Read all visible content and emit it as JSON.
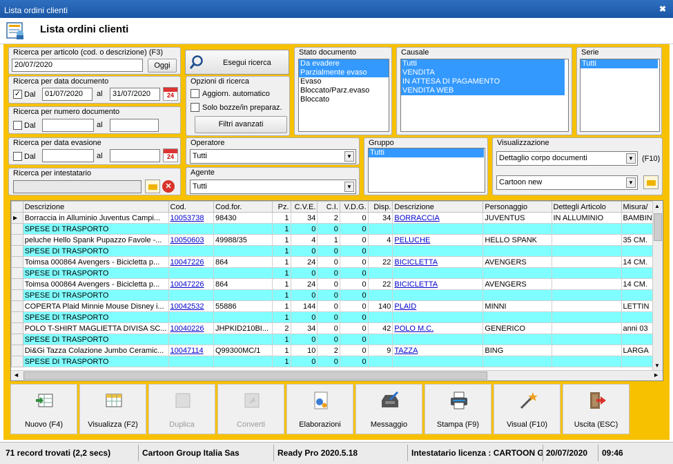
{
  "window": {
    "title": "Lista ordini clienti",
    "header_title": "Lista ordini clienti"
  },
  "search": {
    "article": {
      "legend": "Ricerca per articolo (cod. o descrizione) (F3)",
      "value": "20/07/2020",
      "today_btn": "Oggi"
    },
    "doc_date": {
      "legend": "Ricerca per data documento",
      "chk_label": "Dal",
      "checked": true,
      "from": "01/07/2020",
      "to_label": "al",
      "to": "31/07/2020"
    },
    "doc_num": {
      "legend": "Ricerca per numero documento",
      "chk_label": "Dal",
      "from": "",
      "to_label": "al",
      "to": ""
    },
    "evasion_date": {
      "legend": "Ricerca per data evasione",
      "chk_label": "Dal",
      "from": "",
      "to_label": "al",
      "to": ""
    },
    "holder": {
      "legend": "Ricerca per intestatario",
      "value": ""
    },
    "run_btn": "Esegui ricerca",
    "options": {
      "legend": "Opzioni di ricerca",
      "auto": "Aggiorn. automatico",
      "drafts": "Solo bozze/in preparaz.",
      "adv": "Filtri avanzati"
    },
    "operator": {
      "legend": "Operatore",
      "value": "Tutti"
    },
    "agent": {
      "legend": "Agente",
      "value": "Tutti"
    },
    "state": {
      "legend": "Stato documento",
      "items": [
        "Da evadere",
        "Parzialmente evaso",
        "Evaso",
        "Bloccato/Parz.evaso",
        "Bloccato"
      ],
      "selected": [
        true,
        true,
        false,
        false,
        false
      ]
    },
    "causale": {
      "legend": "Causale",
      "items": [
        "Tutti",
        "VENDITA",
        "IN ATTESA DI PAGAMENTO",
        "VENDITA WEB"
      ],
      "selected": [
        true,
        true,
        true,
        true
      ]
    },
    "serie": {
      "legend": "Serie",
      "items": [
        "Tutti"
      ]
    },
    "gruppo": {
      "legend": "Gruppo",
      "items": [
        "Tutti"
      ]
    },
    "view": {
      "legend": "Visualizzazione",
      "mode": "Dettaglio corpo documenti",
      "key": "(F10)",
      "layout": "Cartoon new"
    }
  },
  "grid": {
    "columns": [
      "Descrizione",
      "Cod.",
      "Cod.for.",
      "Pz.",
      "C.V.E.",
      "C.I.",
      "V.D.G.",
      "Disp.",
      "Descrizione",
      "Personaggio",
      "Dettegli Articolo",
      "Misura/"
    ],
    "rows": [
      {
        "c": [
          "Borraccia in Alluminio Juventus Campi...",
          "10053738",
          "98430",
          "1",
          "34",
          "2",
          "0",
          "34",
          "BORRACCIA",
          "JUVENTUS",
          "IN ALLUMINIO",
          "BAMBIN"
        ],
        "cyan": false,
        "cur": true
      },
      {
        "c": [
          "SPESE DI TRASPORTO",
          "",
          "",
          "1",
          "0",
          "0",
          "0",
          "",
          "",
          "",
          "",
          ""
        ],
        "cyan": true
      },
      {
        "c": [
          "peluche Hello Spank Pupazzo Favole -...",
          "10050603",
          "49988/35",
          "1",
          "4",
          "1",
          "0",
          "4",
          "PELUCHE",
          "HELLO SPANK",
          "",
          "35 CM."
        ],
        "cyan": false
      },
      {
        "c": [
          "SPESE DI TRASPORTO",
          "",
          "",
          "1",
          "0",
          "0",
          "0",
          "",
          "",
          "",
          "",
          ""
        ],
        "cyan": true
      },
      {
        "c": [
          "Toimsa 000864 Avengers - Bicicletta p...",
          "10047226",
          "864",
          "1",
          "24",
          "0",
          "0",
          "22",
          "BICICLETTA",
          "AVENGERS",
          "",
          "14 CM."
        ],
        "cyan": false
      },
      {
        "c": [
          "SPESE DI TRASPORTO",
          "",
          "",
          "1",
          "0",
          "0",
          "0",
          "",
          "",
          "",
          "",
          ""
        ],
        "cyan": true
      },
      {
        "c": [
          "Toimsa 000864 Avengers - Bicicletta p...",
          "10047226",
          "864",
          "1",
          "24",
          "0",
          "0",
          "22",
          "BICICLETTA",
          "AVENGERS",
          "",
          "14 CM."
        ],
        "cyan": false
      },
      {
        "c": [
          "SPESE DI TRASPORTO",
          "",
          "",
          "1",
          "0",
          "0",
          "0",
          "",
          "",
          "",
          "",
          ""
        ],
        "cyan": true
      },
      {
        "c": [
          "COPERTA Plaid Minnie Mouse Disney i...",
          "10042532",
          "55886",
          "1",
          "144",
          "0",
          "0",
          "140",
          "PLAID",
          "MINNI",
          "",
          "LETTIN"
        ],
        "cyan": false
      },
      {
        "c": [
          "SPESE DI TRASPORTO",
          "",
          "",
          "1",
          "0",
          "0",
          "0",
          "",
          "",
          "",
          "",
          ""
        ],
        "cyan": true
      },
      {
        "c": [
          "POLO T-SHIRT MAGLIETTA DIVISA SC...",
          "10040226",
          "JHPKID210BI...",
          "2",
          "34",
          "0",
          "0",
          "42",
          "POLO M.C.",
          "GENERICO",
          "",
          "anni 03"
        ],
        "cyan": false
      },
      {
        "c": [
          "SPESE DI TRASPORTO",
          "",
          "",
          "1",
          "0",
          "0",
          "0",
          "",
          "",
          "",
          "",
          ""
        ],
        "cyan": true
      },
      {
        "c": [
          "Di&Gi Tazza Colazione Jumbo Ceramic...",
          "10047114",
          "Q99300MC/1",
          "1",
          "10",
          "2",
          "0",
          "9",
          "TAZZA",
          "BING",
          "",
          "LARGA"
        ],
        "cyan": false
      },
      {
        "c": [
          "SPESE DI TRASPORTO",
          "",
          "",
          "1",
          "0",
          "0",
          "0",
          "",
          "",
          "",
          "",
          ""
        ],
        "cyan": true
      }
    ]
  },
  "actions": [
    "Nuovo (F4)",
    "Visualizza (F2)",
    "Duplica",
    "Converti",
    "Elaborazioni",
    "Messaggio",
    "Stampa (F9)",
    "Visual (F10)",
    "Uscita (ESC)"
  ],
  "status": {
    "records": "71 record trovati (2,2 secs)",
    "company": "Cartoon Group Italia Sas",
    "version": "Ready Pro 2020.5.18",
    "license": "Intestatario licenza : CARTOON GR",
    "date": "20/07/2020",
    "time": "09:46"
  }
}
